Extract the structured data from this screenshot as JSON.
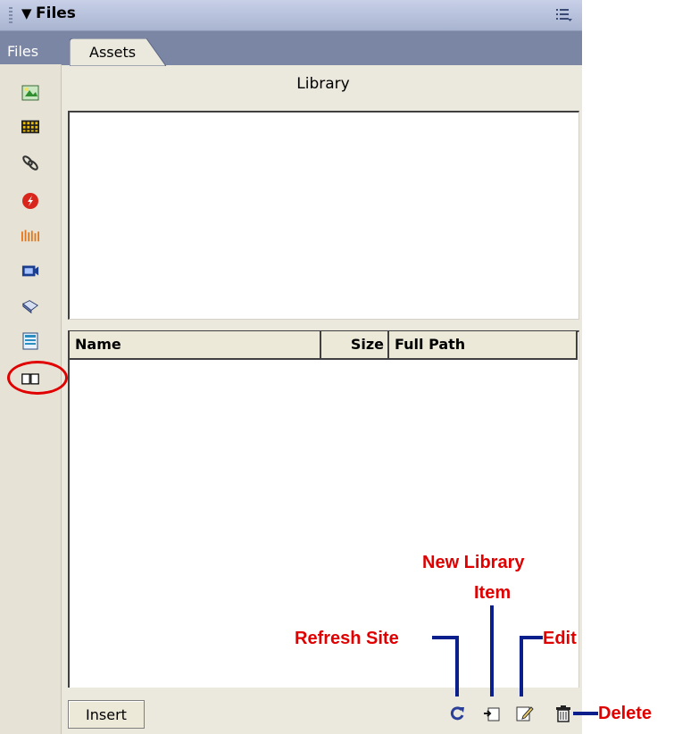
{
  "panel": {
    "title": "Files",
    "tabs": [
      {
        "label": "Files",
        "active": false
      },
      {
        "label": "Assets",
        "active": true
      }
    ],
    "section_title": "Library",
    "columns": [
      {
        "label": "Name"
      },
      {
        "label": "Size"
      },
      {
        "label": "Full Path"
      }
    ],
    "insert_label": "Insert"
  },
  "sidebar": {
    "icons": [
      "images-icon",
      "colors-icon",
      "urls-icon",
      "flash-icon",
      "shockwave-icon",
      "movies-icon",
      "scripts-icon",
      "templates-icon",
      "library-icon"
    ],
    "selected": "library-icon"
  },
  "callouts": {
    "refresh": "Refresh Site",
    "new_item_line1": "New Library",
    "new_item_line2": "Item",
    "edit": "Edit",
    "delete": "Delete"
  },
  "colors": {
    "callout_text": "#e00000",
    "callout_line": "#0b1f8c",
    "highlight": "#e00000"
  }
}
